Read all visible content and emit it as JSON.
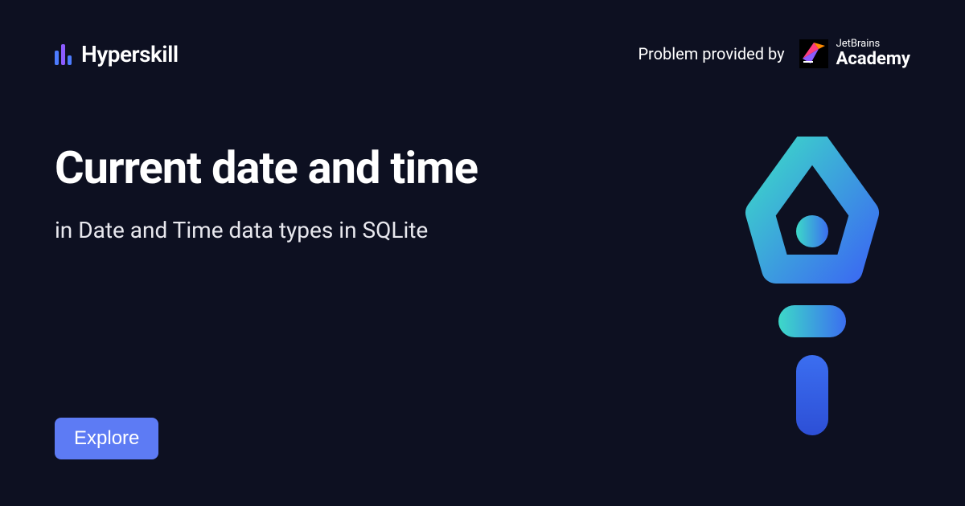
{
  "header": {
    "brand": "Hyperskill",
    "provider_label": "Problem provided by",
    "academy_small": "JetBrains",
    "academy_big": "Academy"
  },
  "main": {
    "title": "Current date and time",
    "subtitle": "in Date and Time data types in SQLite"
  },
  "cta": {
    "explore": "Explore"
  }
}
